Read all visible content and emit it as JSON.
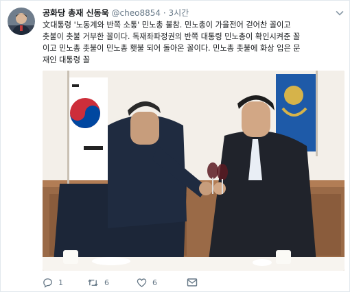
{
  "tweet": {
    "display_name": "공화당 총재 신동욱",
    "handle": "@cheo8854",
    "separator": "·",
    "time": "3시간",
    "text_lines": [
      "文대통령 '노동계와 반쪽 소통' 민노총 불참. 민노총이 가을전어 걷어찬 꼴이고",
      "촛불이 촛불 거부한 꼴이다. 독재좌파정권의 반쪽 대통령 민노총이 확인시켜준 꼴",
      "이고 민노총 촛불이 민노총 횃불 되어 돌아온 꼴이다. 민노총 촛불에 화상 입은 문",
      "재인 대통령 꼴"
    ],
    "actions": {
      "reply_count": "1",
      "retweet_count": "6",
      "like_count": "6"
    }
  },
  "icons": {
    "more": "chevron-down-icon",
    "reply": "reply-icon",
    "retweet": "retweet-icon",
    "like": "heart-icon",
    "message": "envelope-icon"
  },
  "colors": {
    "text": "#14171a",
    "secondary": "#657786",
    "border": "#e1e8ed"
  }
}
